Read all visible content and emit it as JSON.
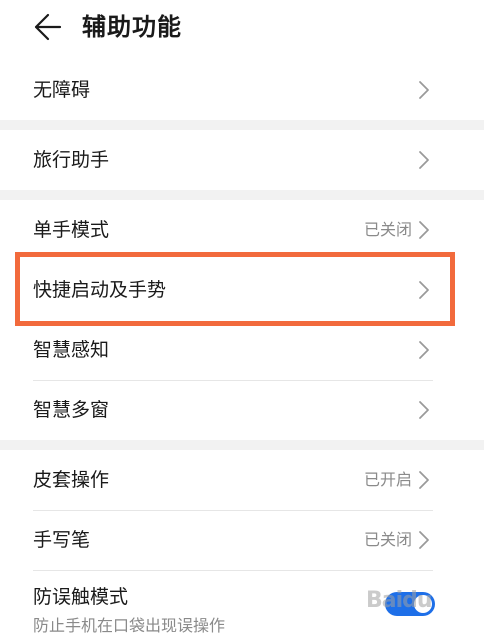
{
  "header": {
    "title": "辅助功能",
    "back_icon": "arrow-left-icon"
  },
  "rows": [
    {
      "label": "无障碍",
      "status": ""
    },
    {
      "label": "旅行助手",
      "status": ""
    },
    {
      "label": "单手模式",
      "status": "已关闭"
    },
    {
      "label": "快捷启动及手势",
      "status": ""
    },
    {
      "label": "智慧感知",
      "status": ""
    },
    {
      "label": "智慧多窗",
      "status": ""
    },
    {
      "label": "皮套操作",
      "status": "已开启"
    },
    {
      "label": "手写笔",
      "status": "已关闭"
    }
  ],
  "last_row": {
    "label": "防误触模式",
    "description": "防止手机在口袋出现误操作",
    "toggle_on": true
  },
  "watermark": "Baidu",
  "colors": {
    "highlight": "#f26a3c",
    "toggle": "#1e6fe8",
    "section_gap": "#f2f2f2"
  }
}
